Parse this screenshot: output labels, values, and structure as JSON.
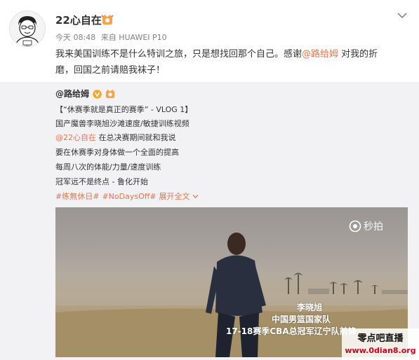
{
  "post": {
    "username": "22心自在",
    "timestamp": "今天 08:48",
    "source": "来自 HUAWEI P10",
    "text_lines": [
      {
        "a": "我来美国训练不是什么特训之旅，只是想找回那个自己。感谢",
        "mention": "@路给姆",
        "b": " 对我的折"
      },
      {
        "a": "磨，回国之前请赔我袜子！"
      }
    ]
  },
  "repost": {
    "author": "@路给姆",
    "lines": [
      "【“休赛季就是真正的赛季” - VLOG 1】",
      "国产魔兽李晓旭沙滩速度/敏捷训练视频"
    ],
    "mention_line": {
      "mention": "@22心自在",
      "rest": " 在总决赛期间就和我说"
    },
    "more_lines": [
      "要在休赛季对身体做一个全面的提高",
      "每周八次的体能/力量/速度训练",
      "冠军远不是终点 - 鲁化开始"
    ],
    "hashtags": [
      "#练無休日#",
      "#NoDaysOff#"
    ],
    "expand_label": "展开全文"
  },
  "video": {
    "watermark": "秒拍",
    "caption_name": "李晓旭",
    "caption_team": "中国男篮国家队",
    "caption_title": "17-18赛季CBA总冠军辽宁队前锋"
  },
  "site_watermark": {
    "title": "零点吧直播",
    "url": "www.0dian8.org"
  },
  "colors": {
    "accent": "#eb7350",
    "repost_bg": "#f2f2f5",
    "meta": "#808080"
  },
  "icons": [
    "avatar-cartoon",
    "vip-badge-icon",
    "chevron-down-icon",
    "verified-v-icon",
    "miaopai-logo-icon"
  ]
}
